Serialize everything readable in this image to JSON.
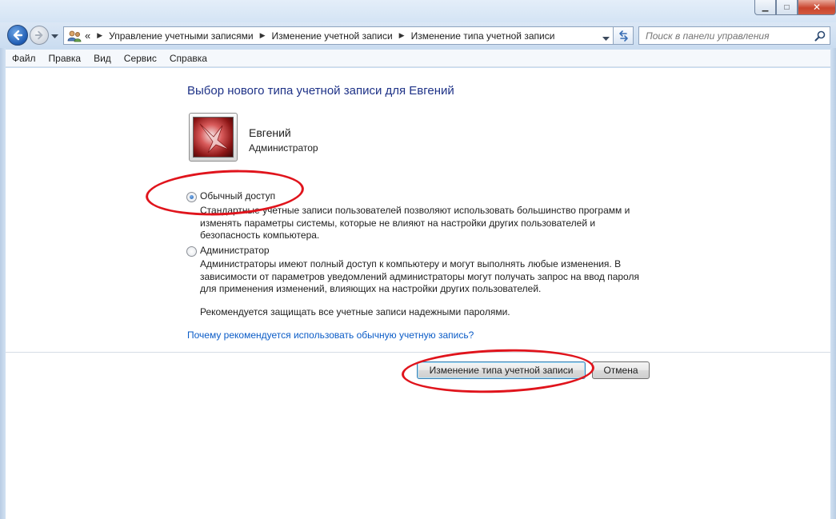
{
  "window": {
    "minimize_glyph": "▁",
    "maximize_glyph": "□",
    "close_glyph": "✕"
  },
  "nav": {
    "breadcrumb_overflow": "«",
    "breadcrumbs": [
      "Управление учетными записями",
      "Изменение учетной записи",
      "Изменение типа учетной записи"
    ],
    "search_placeholder": "Поиск в панели управления"
  },
  "menu": {
    "items": [
      "Файл",
      "Правка",
      "Вид",
      "Сервис",
      "Справка"
    ]
  },
  "page": {
    "heading": "Выбор нового типа учетной записи для Евгений",
    "user": {
      "name": "Евгений",
      "role": "Администратор"
    },
    "options": [
      {
        "label": "Обычный доступ",
        "checked": true,
        "description": [
          "Стандартные учетные записи пользователей позволяют использовать большинство программ и",
          "изменять параметры системы, которые не влияют на настройки других пользователей и",
          "безопасность компьютера."
        ]
      },
      {
        "label": "Администратор",
        "checked": false,
        "description": [
          "Администраторы имеют полный доступ к компьютеру и могут выполнять любые изменения. В",
          "зависимости от параметров уведомлений администраторы могут получать запрос на ввод пароля",
          "для применения изменений, влияющих на настройки других пользователей."
        ],
        "note": "Рекомендуется защищать все учетные записи надежными паролями."
      }
    ],
    "help_link": "Почему рекомендуется использовать обычную учетную запись?",
    "buttons": {
      "change": "Изменение типа учетной записи",
      "cancel": "Отмена"
    }
  },
  "colors": {
    "heading": "#1e3287",
    "link": "#0b5cc7",
    "annotation": "#e0141c"
  }
}
